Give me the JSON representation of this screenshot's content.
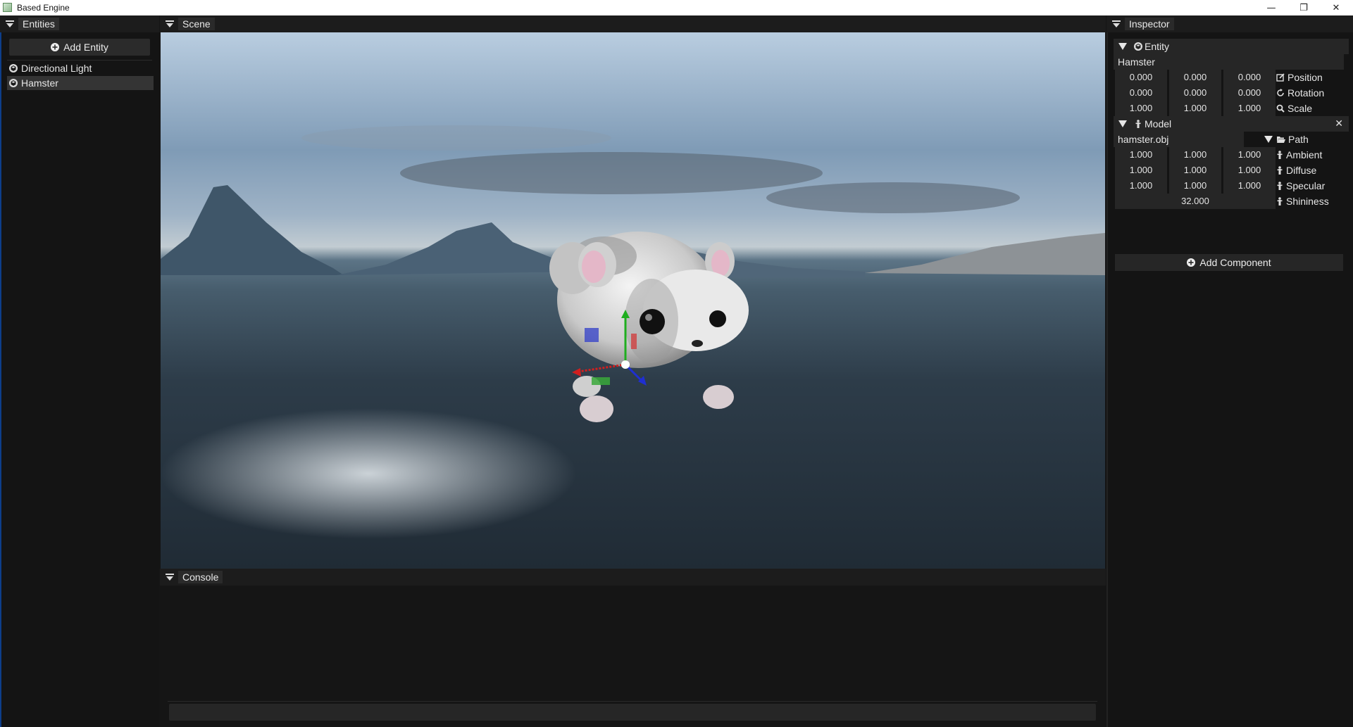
{
  "window": {
    "title": "Based Engine",
    "controls": {
      "minimize": "—",
      "maximize": "❐",
      "close": "✕"
    }
  },
  "entities_panel": {
    "tab": "Entities",
    "add_button": "Add Entity",
    "items": [
      {
        "label": "Directional Light",
        "selected": false
      },
      {
        "label": "Hamster",
        "selected": true
      }
    ]
  },
  "scene_panel": {
    "tab": "Scene"
  },
  "console_panel": {
    "tab": "Console",
    "input_value": ""
  },
  "inspector": {
    "tab": "Inspector",
    "entity": {
      "header": "Entity",
      "name": "Hamster",
      "position": {
        "label": "Position",
        "values": [
          "0.000",
          "0.000",
          "0.000"
        ]
      },
      "rotation": {
        "label": "Rotation",
        "values": [
          "0.000",
          "0.000",
          "0.000"
        ]
      },
      "scale": {
        "label": "Scale",
        "values": [
          "1.000",
          "1.000",
          "1.000"
        ]
      }
    },
    "model": {
      "header": "Model",
      "close": "✕",
      "path": {
        "label": "Path",
        "value": "hamster.obj"
      },
      "ambient": {
        "label": "Ambient",
        "values": [
          "1.000",
          "1.000",
          "1.000"
        ]
      },
      "diffuse": {
        "label": "Diffuse",
        "values": [
          "1.000",
          "1.000",
          "1.000"
        ]
      },
      "specular": {
        "label": "Specular",
        "values": [
          "1.000",
          "1.000",
          "1.000"
        ]
      },
      "shininess": {
        "label": "Shininess",
        "value": "32.000"
      }
    },
    "add_component": "Add Component"
  },
  "colors": {
    "panel_bg": "#141414",
    "field_bg": "#262626",
    "gizmo_x": "#d11f1f",
    "gizmo_y": "#1fae1f",
    "gizmo_z": "#1f2fd1"
  }
}
